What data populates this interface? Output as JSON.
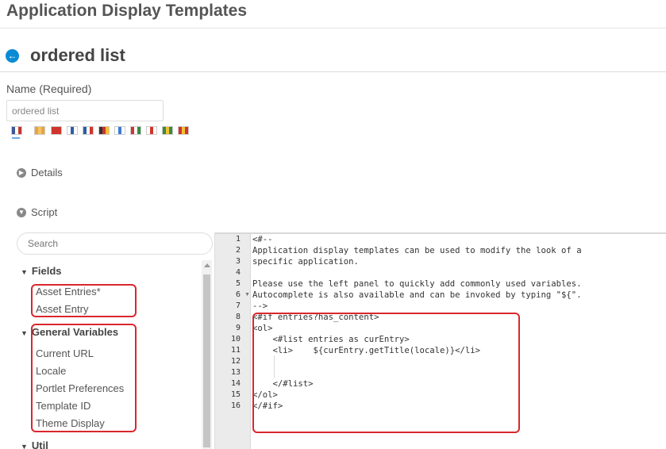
{
  "header": {
    "title": "Application Display Templates"
  },
  "template": {
    "back_icon": "arrow-left-icon",
    "title": "ordered list"
  },
  "name_field": {
    "label": "Name (Required)",
    "value": "ordered list"
  },
  "locale_flags": [
    {
      "name": "flag-us",
      "colors": [
        "#3b5998",
        "#ffffff",
        "#c0392b"
      ]
    },
    {
      "name": "flag-ca",
      "colors": [
        "#e8a33d",
        "#f4c46a",
        "#e8a33d"
      ]
    },
    {
      "name": "flag-cn",
      "colors": [
        "#d0342c",
        "#d0342c",
        "#d0342c"
      ]
    },
    {
      "name": "flag-fi",
      "colors": [
        "#ffffff",
        "#2b5ea7",
        "#ffffff"
      ]
    },
    {
      "name": "flag-fr",
      "colors": [
        "#2b5ea7",
        "#ffffff",
        "#d0342c"
      ]
    },
    {
      "name": "flag-de",
      "colors": [
        "#333333",
        "#d0342c",
        "#f1c232"
      ]
    },
    {
      "name": "flag-il",
      "colors": [
        "#ffffff",
        "#3b7bd4",
        "#ffffff"
      ]
    },
    {
      "name": "flag-hu",
      "colors": [
        "#d0342c",
        "#ffffff",
        "#3b8a3e"
      ]
    },
    {
      "name": "flag-jp",
      "colors": [
        "#ffffff",
        "#d0342c",
        "#ffffff"
      ]
    },
    {
      "name": "flag-br",
      "colors": [
        "#3b8a3e",
        "#f1c232",
        "#3b8a3e"
      ]
    },
    {
      "name": "flag-es",
      "colors": [
        "#d0342c",
        "#f1c232",
        "#d0342c"
      ]
    }
  ],
  "panels": {
    "details": "Details",
    "script": "Script"
  },
  "search": {
    "placeholder": "Search"
  },
  "variables": {
    "fields": {
      "title": "Fields",
      "items": [
        "Asset Entries*",
        "Asset Entry"
      ]
    },
    "general": {
      "title": "General Variables",
      "items": [
        "Current URL",
        "Locale",
        "Portlet Preferences",
        "Template ID",
        "Theme Display"
      ]
    },
    "util": {
      "title": "Util"
    }
  },
  "editor": {
    "line_numbers": [
      "1",
      "2",
      "3",
      "4",
      "5",
      "6",
      "7",
      "8",
      "9",
      "10",
      "11",
      "12",
      "13",
      "14",
      "15",
      "16"
    ],
    "lines": [
      "<#--",
      "Application display templates can be used to modify the look of a",
      "specific application.",
      "",
      "Please use the left panel to quickly add commonly used variables.",
      "Autocomplete is also available and can be invoked by typing \"${\".",
      "-->",
      "<#if entries?has_content>",
      "<ol>",
      "    <#list entries as curEntry>",
      "    <li>    ${curEntry.getTitle(locale)}</li>",
      "",
      "",
      "    </#list>",
      "</ol>",
      "</#if>"
    ]
  },
  "highlight_color": "#d9272e",
  "accent_color": "#0b8bd4"
}
